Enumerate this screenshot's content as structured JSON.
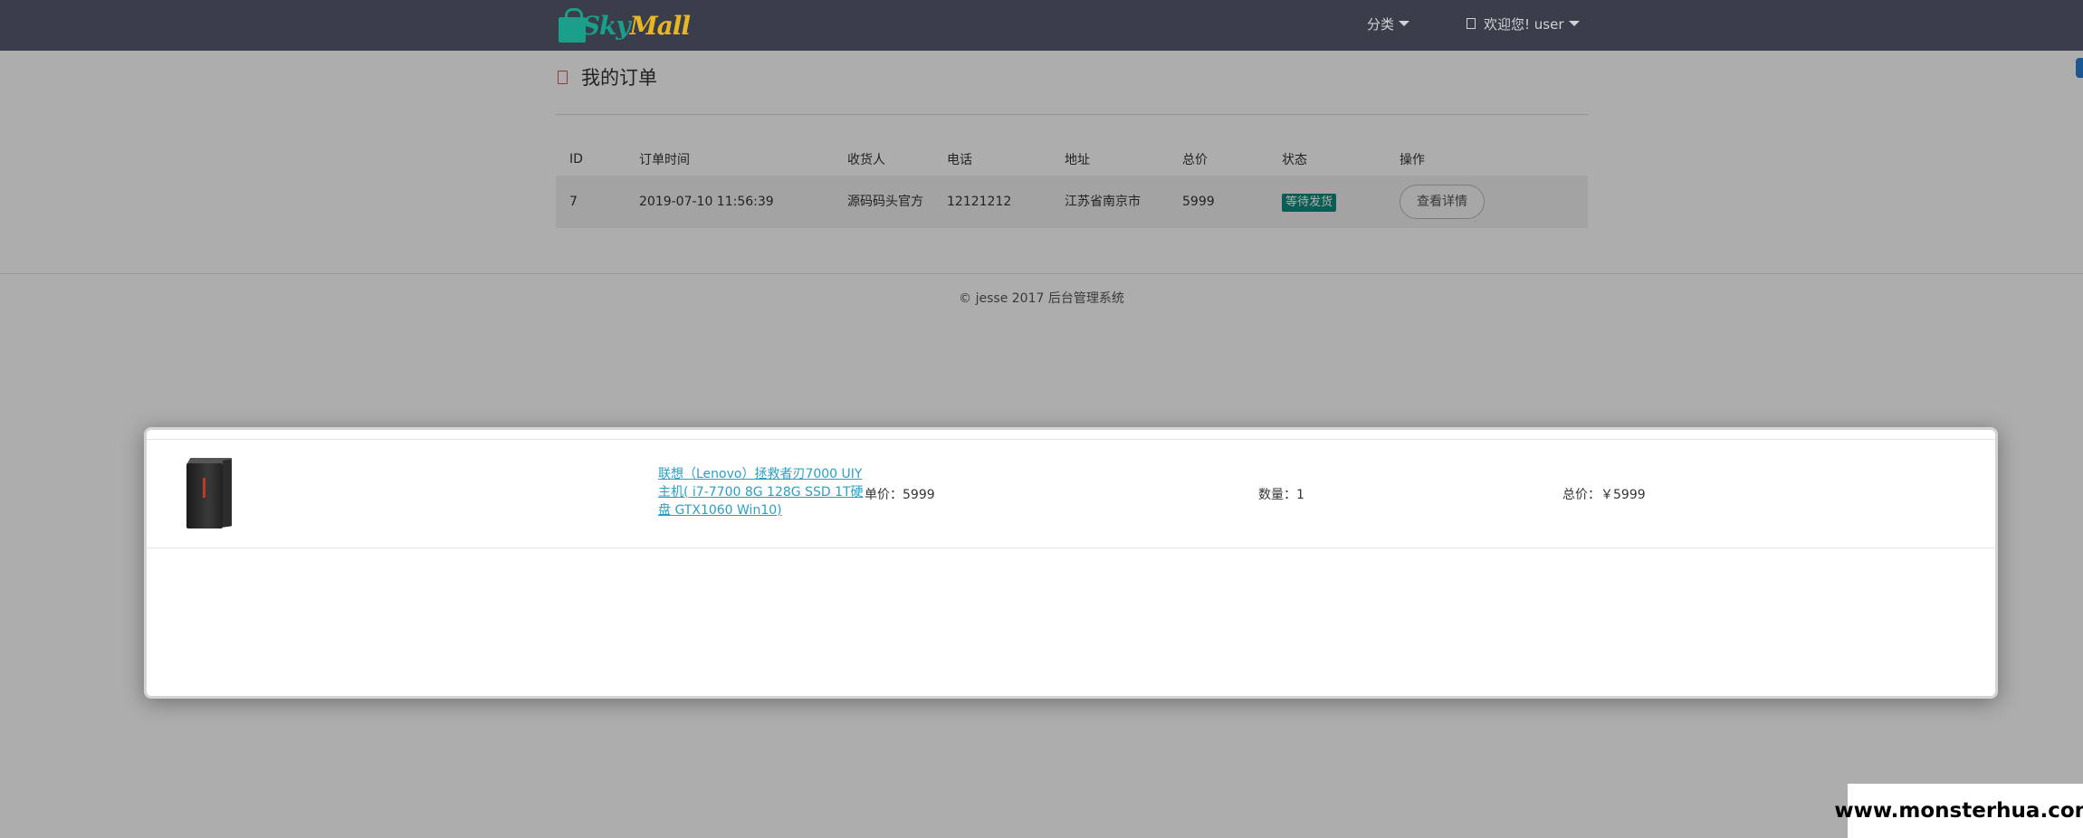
{
  "navbar": {
    "brand": {
      "sky": "Sky",
      "mall": "Mall"
    },
    "category_menu": "分类",
    "user_menu": "欢迎您! user"
  },
  "page": {
    "title": "我的订单"
  },
  "orders_table": {
    "columns": [
      "ID",
      "订单时间",
      "收货人",
      "电话",
      "地址",
      "总价",
      "状态",
      "操作"
    ],
    "rows": [
      {
        "id": "7",
        "time": "2019-07-10 11:56:39",
        "receiver": "源码码头官方",
        "phone": "12121212",
        "address": "江苏省南京市",
        "total": "5999",
        "status": "等待发货",
        "action": "查看详情"
      }
    ]
  },
  "footer": {
    "text": "© jesse 2017  后台管理系统"
  },
  "modal": {
    "items": [
      {
        "image_icon": "desktop-pc-tower",
        "name": "联想（Lenovo）拯救者刃7000 UIY主机( i7-7700 8G 128G SSD 1T硬盘 GTX1060 Win10)",
        "unit_price": "单价：5999",
        "quantity": "数量：1",
        "subtotal": "总价：￥5999"
      }
    ]
  },
  "watermark": "www.monsterhua.com",
  "colors": {
    "navbar_bg": "#3a3d4a",
    "brand_green": "#1aa08a",
    "brand_yellow": "#e9b623",
    "status_badge": "#0f8a7c",
    "link": "#2a9fc4"
  }
}
